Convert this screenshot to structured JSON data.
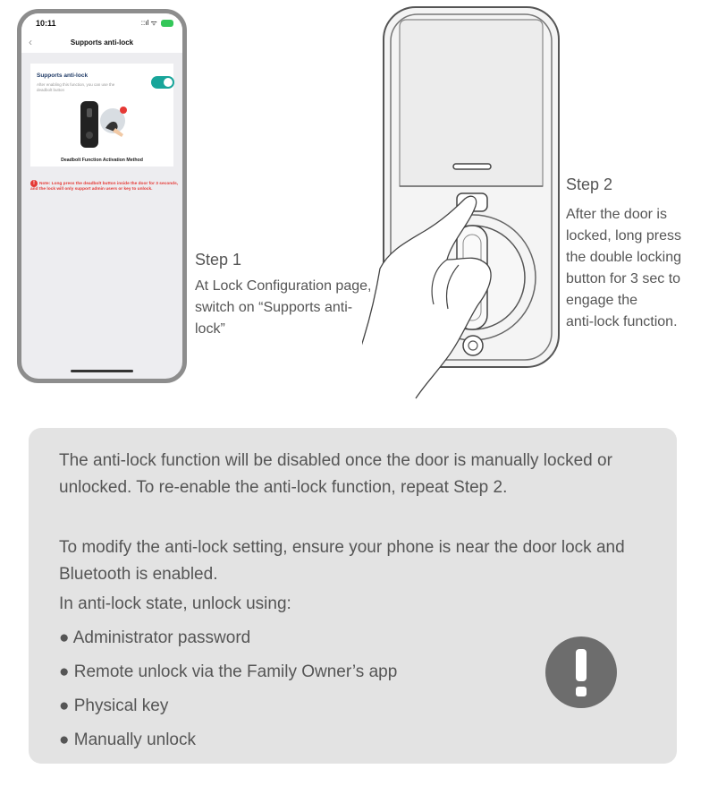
{
  "phone": {
    "status_time": "10:11",
    "status_icons": "::ıl ᯤ",
    "nav_title": "Supports anti-lock",
    "setting_label": "Supports anti-lock",
    "setting_desc": "After enabling this function, you can use the deadbolt button",
    "toggle_on": true,
    "method_caption": "Deadbolt Function Activation Method",
    "note": "Note: Long press the deadbolt button inside the door for 3 seconds, and the lock will only support admin users or key to unlock.",
    "accent_color": "#18a59a",
    "note_color": "#e53935"
  },
  "step1": {
    "title": "Step 1",
    "body": "At Lock Configuration page, switch on “Supports anti-lock”"
  },
  "step2": {
    "title": "Step 2",
    "body": "After the door is\nlocked, long press\nthe double locking\nbutton for 3 sec to\nengage the\nanti-lock function."
  },
  "info": {
    "para1": "The anti-lock function will be disabled once the door is manually locked or unlocked. To re-enable the anti-lock function, repeat Step 2.",
    "para2": "To modify the anti-lock setting, ensure your phone is near the door lock and Bluetooth is enabled.",
    "para3": "In anti-lock state, unlock using:",
    "bullets": [
      "● Administrator password",
      "● Remote unlock via the Family Owner’s app",
      "● Physical key",
      "● Manually unlock"
    ],
    "warning_icon": "exclamation-icon",
    "box_color": "#e3e3e3"
  }
}
